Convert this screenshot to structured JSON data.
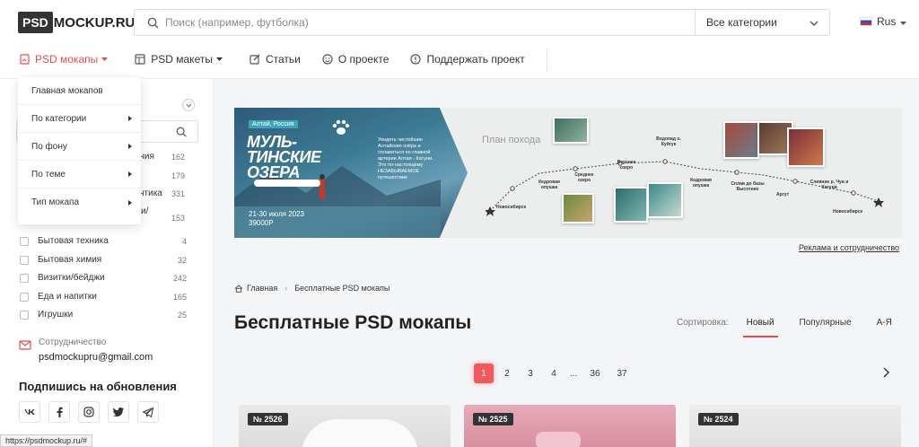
{
  "header": {
    "logo_box": "PSD",
    "logo_text": "MOCKUP.RU",
    "search_placeholder": "Поиск (например, футболка)",
    "category_select": "Все категории",
    "language": "Rus"
  },
  "nav": {
    "items": [
      {
        "label": "PSD мокапы",
        "icon": "file-image-icon"
      },
      {
        "label": "PSD макеты",
        "icon": "layout-icon"
      },
      {
        "label": "Статьи",
        "icon": "edit-icon"
      },
      {
        "label": "О проекте",
        "icon": "smile-icon"
      },
      {
        "label": "Поддержать проект",
        "icon": "donate-icon"
      }
    ]
  },
  "dropdown": {
    "items": [
      "Главная мокапов",
      "По категории",
      "По фону",
      "По теме",
      "Тип мокапа"
    ]
  },
  "sidebar": {
    "partial_rows": [
      {
        "text": "ления",
        "count": "162"
      },
      {
        "text": "",
        "count": "179"
      },
      {
        "text": "нтика",
        "count": "331"
      },
      {
        "text": "и/",
        "count": ""
      },
      {
        "text": "книги",
        "count": "153"
      }
    ],
    "categories": [
      {
        "label": "Бытовая техника",
        "count": "4"
      },
      {
        "label": "Бытовая химия",
        "count": "32"
      },
      {
        "label": "Визитки/бейджи",
        "count": "242"
      },
      {
        "label": "Еда и напитки",
        "count": "165"
      },
      {
        "label": "Игрушки",
        "count": "25"
      }
    ],
    "contact_label": "Сотрудничество",
    "contact_email": "psdmockupru@gmail.com",
    "subscribe_title": "Подпишись на обновления",
    "socials": [
      "vk-icon",
      "facebook-icon",
      "instagram-icon",
      "twitter-icon",
      "telegram-icon"
    ]
  },
  "banner": {
    "tag": "Алтай, Россия",
    "title_line1": "МУЛЬ-",
    "title_line2": "ТИНСКИЕ",
    "title_line3": "ОЗЕРА",
    "description": "Увидеть чистейшие Алтайские озёра и сплавиться по главной артерии Алтая - Катуни. Это по-настоящему НЕЗАБЫВАЕМОЕ путешествие",
    "dates": "21-30 июля 2023",
    "price": "39000Р",
    "plan_title": "План похода",
    "places": [
      "Новосибирск",
      "Кедровая опушка",
      "Среднее озеро",
      "Верхнее озеро",
      "Водопад о. Куйгук",
      "Кедровая опушка",
      "Сплав до базы Высотних",
      "Аргут",
      "Слияние р. Чуи и Катуни",
      "Новосибирск"
    ]
  },
  "ad_link": "Реклама и сотрудничество",
  "breadcrumb": {
    "home": "Главная",
    "current": "Бесплатные PSD мокапы"
  },
  "page_title": "Бесплатные PSD мокапы",
  "sort": {
    "label": "Сортировка:",
    "options": [
      "Новый",
      "Популярные",
      "А-Я"
    ]
  },
  "pagination": {
    "pages": [
      "1",
      "2",
      "3",
      "4",
      "...",
      "36",
      "37"
    ],
    "current": "1"
  },
  "cards": [
    {
      "badge": "№ 2526"
    },
    {
      "badge": "№ 2525"
    },
    {
      "badge": "№ 2524"
    }
  ],
  "status_url": "https://psdmockup.ru/#",
  "colors": {
    "accent": "#e74c4c",
    "pager_active": "#f05a5a",
    "main_bg": "#f4f5f7"
  }
}
